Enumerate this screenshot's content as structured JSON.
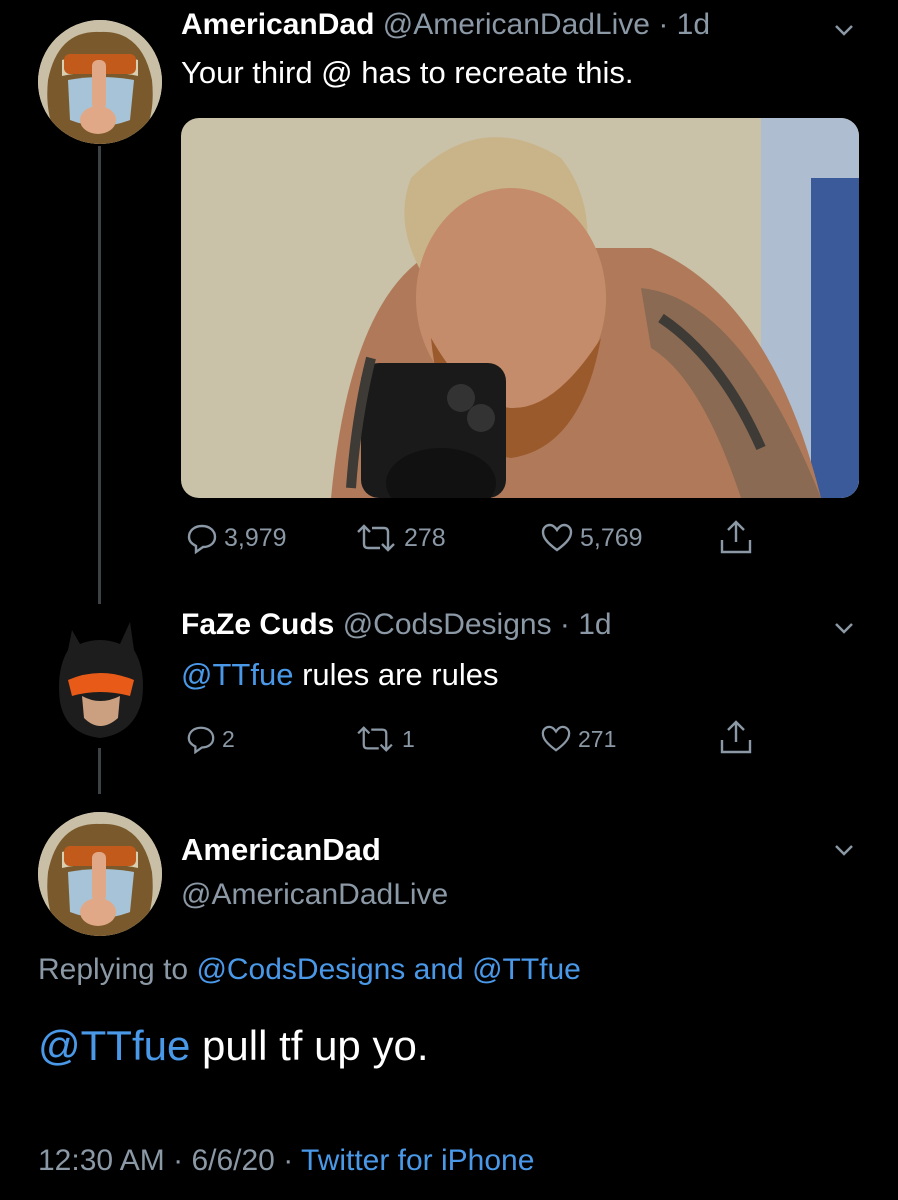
{
  "tweet1": {
    "display_name": "AmericanDad",
    "handle": "@AmericanDadLive",
    "age": "1d",
    "text": "Your third @ has to recreate this.",
    "replies": "3,979",
    "retweets": "278",
    "likes": "5,769"
  },
  "tweet2": {
    "display_name": "FaZe Cuds",
    "handle": "@CodsDesigns",
    "age": "1d",
    "mention": "@TTfue",
    "text": "rules are rules",
    "replies": "2",
    "retweets": "1",
    "likes": "271"
  },
  "main": {
    "display_name": "AmericanDad",
    "handle": "@AmericanDadLive",
    "replying_prefix": "Replying to",
    "replying_user1": "@CodsDesigns",
    "replying_and": "and",
    "replying_user2": "@TTfue",
    "mention": "@TTfue",
    "text": "pull tf up yo.",
    "time": "12:30 AM",
    "date": "6/6/20",
    "source": "Twitter for iPhone"
  },
  "colors": {
    "link": "#4a99e9",
    "muted": "#8b98a5",
    "background": "#000000"
  }
}
